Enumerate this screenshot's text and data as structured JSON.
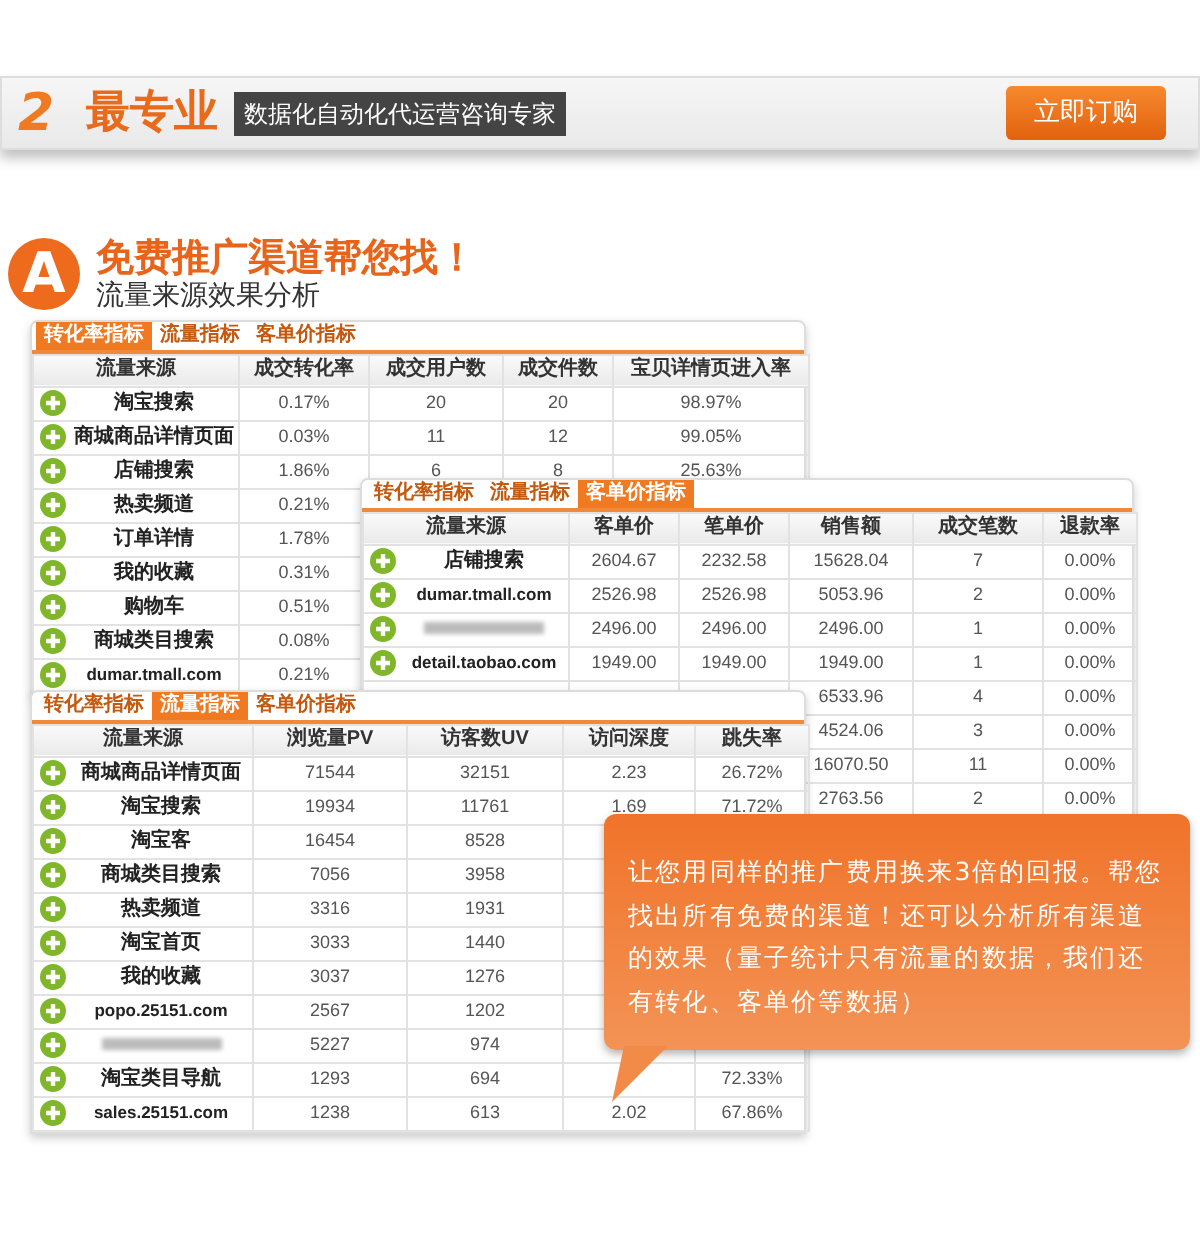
{
  "banner": {
    "number": "2",
    "title": "最专业",
    "tagline": "数据化自动化代运营咨询专家",
    "button": "立即订购"
  },
  "section": {
    "letter": "A",
    "title": "免费推广渠道帮您找！",
    "subtitle": "流量来源效果分析"
  },
  "panels": [
    {
      "tabs": [
        {
          "label": "转化率指标",
          "selected": true
        },
        {
          "label": "流量指标",
          "selected": false
        },
        {
          "label": "客单价指标",
          "selected": false
        }
      ],
      "columns": [
        "流量来源",
        "成交转化率",
        "成交用户数",
        "成交件数",
        "宝贝详情页进入率"
      ],
      "rows": [
        {
          "kind": "source",
          "cells": [
            "淘宝搜索",
            "0.17%",
            "20",
            "20",
            "98.97%"
          ]
        },
        {
          "kind": "source",
          "cells": [
            "商城商品详情页面",
            "0.03%",
            "11",
            "12",
            "99.05%"
          ]
        },
        {
          "kind": "source",
          "cells": [
            "店铺搜索",
            "1.86%",
            "6",
            "8",
            "25.63%"
          ]
        },
        {
          "kind": "source",
          "cells": [
            "热卖频道",
            "0.21%",
            null,
            null,
            null
          ]
        },
        {
          "kind": "source",
          "cells": [
            "订单详情",
            "1.78%",
            null,
            null,
            null
          ]
        },
        {
          "kind": "source",
          "cells": [
            "我的收藏",
            "0.31%",
            null,
            null,
            null
          ]
        },
        {
          "kind": "source",
          "cells": [
            "购物车",
            "0.51%",
            null,
            null,
            null
          ]
        },
        {
          "kind": "source",
          "cells": [
            "商城类目搜索",
            "0.08%",
            null,
            null,
            null
          ]
        },
        {
          "kind": "source",
          "cells": [
            "dumar.tmall.com",
            "0.21%",
            null,
            null,
            null
          ]
        }
      ]
    },
    {
      "tabs": [
        {
          "label": "转化率指标",
          "selected": false
        },
        {
          "label": "流量指标",
          "selected": false
        },
        {
          "label": "客单价指标",
          "selected": true
        }
      ],
      "columns": [
        "流量来源",
        "客单价",
        "笔单价",
        "销售额",
        "成交笔数",
        "退款率"
      ],
      "rows": [
        {
          "kind": "source",
          "cells": [
            "店铺搜索",
            "2604.67",
            "2232.58",
            "15628.04",
            "7",
            "0.00%"
          ]
        },
        {
          "kind": "source",
          "cells": [
            "dumar.tmall.com",
            "2526.98",
            "2526.98",
            "5053.96",
            "2",
            "0.00%"
          ]
        },
        {
          "kind": "blurred",
          "cells": [
            null,
            "2496.00",
            "2496.00",
            "2496.00",
            "1",
            "0.00%"
          ]
        },
        {
          "kind": "source",
          "cells": [
            "detail.taobao.com",
            "1949.00",
            "1949.00",
            "1949.00",
            "1",
            "0.00%"
          ]
        },
        {
          "kind": "covered",
          "cells": [
            null,
            null,
            null,
            "6533.96",
            "4",
            "0.00%"
          ]
        },
        {
          "kind": "covered",
          "cells": [
            null,
            null,
            null,
            "4524.06",
            "3",
            "0.00%"
          ]
        },
        {
          "kind": "covered",
          "cells": [
            null,
            null,
            null,
            "16070.50",
            "11",
            "0.00%"
          ]
        },
        {
          "kind": "covered",
          "cells": [
            null,
            null,
            null,
            "2763.56",
            "2",
            "0.00%"
          ]
        }
      ]
    },
    {
      "tabs": [
        {
          "label": "转化率指标",
          "selected": false
        },
        {
          "label": "流量指标",
          "selected": true
        },
        {
          "label": "客单价指标",
          "selected": false
        }
      ],
      "columns": [
        "流量来源",
        "浏览量PV",
        "访客数UV",
        "访问深度",
        "跳失率"
      ],
      "rows": [
        {
          "kind": "source",
          "cells": [
            "商城商品详情页面",
            "71544",
            "32151",
            "2.23",
            "26.72%"
          ]
        },
        {
          "kind": "source",
          "cells": [
            "淘宝搜索",
            "19934",
            "11761",
            "1.69",
            "71.72%"
          ]
        },
        {
          "kind": "source",
          "cells": [
            "淘宝客",
            "16454",
            "8528",
            null,
            null
          ]
        },
        {
          "kind": "source",
          "cells": [
            "商城类目搜索",
            "7056",
            "3958",
            null,
            null
          ]
        },
        {
          "kind": "source",
          "cells": [
            "热卖频道",
            "3316",
            "1931",
            null,
            null
          ]
        },
        {
          "kind": "source",
          "cells": [
            "淘宝首页",
            "3033",
            "1440",
            null,
            null
          ]
        },
        {
          "kind": "source",
          "cells": [
            "我的收藏",
            "3037",
            "1276",
            null,
            null
          ]
        },
        {
          "kind": "source",
          "cells": [
            "popo.25151.com",
            "2567",
            "1202",
            null,
            null
          ]
        },
        {
          "kind": "blurred",
          "cells": [
            null,
            "5227",
            "974",
            null,
            null
          ]
        },
        {
          "kind": "source",
          "cells": [
            "淘宝类目导航",
            "1293",
            "694",
            null,
            "72.33%"
          ]
        },
        {
          "kind": "source",
          "cells": [
            "sales.25151.com",
            "1238",
            "613",
            "2.02",
            "67.86%"
          ]
        }
      ]
    }
  ],
  "callout": {
    "text": "让您用同样的推广费用换来3倍的回报。帮您找出所有免费的渠道！还可以分析所有渠道的效果（量子统计只有流量的数据，我们还有转化、客单价等数据）"
  }
}
